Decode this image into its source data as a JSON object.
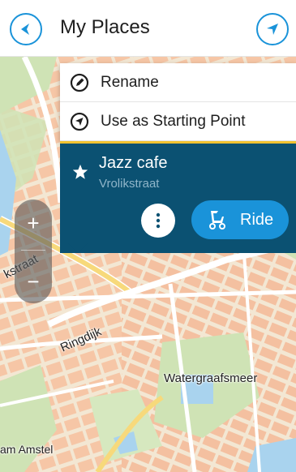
{
  "header": {
    "title": "My Places",
    "back_icon": "back-arrow-icon",
    "locate_icon": "navigation-arrow-icon"
  },
  "popup": {
    "menu": [
      {
        "label": "Rename",
        "icon": "pencil-icon"
      },
      {
        "label": "Use as Starting Point",
        "icon": "starting-point-icon"
      }
    ],
    "place": {
      "name": "Jazz cafe",
      "street": "Vrolikstraat",
      "favorite_icon": "star-icon"
    },
    "ride_label": "Ride",
    "more_icon": "more-vertical-icon",
    "ride_icon": "scooter-icon"
  },
  "map": {
    "labels": {
      "rkstraat": "kstraat",
      "ringdijk": "Ringdijk",
      "watergraafsmeer": "Watergraafsmeer",
      "amstel": "am Amstel"
    }
  },
  "zoom": {
    "in_label": "+",
    "out_label": "−"
  },
  "colors": {
    "accent": "#1a93d9",
    "card": "#0b5172",
    "highlight": "#f2c230",
    "map_base": "#f3e7d3"
  }
}
